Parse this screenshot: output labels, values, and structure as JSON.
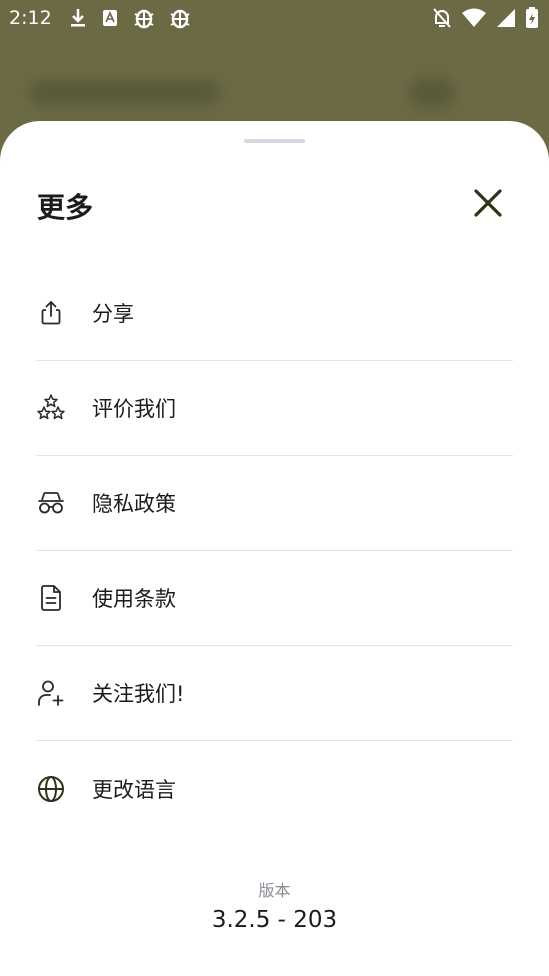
{
  "status_bar": {
    "time": "2:12",
    "left_icons": [
      "download-icon",
      "a-icon",
      "bug-icon",
      "bug-icon"
    ],
    "right_icons": [
      "bell-off-icon",
      "wifi-icon",
      "signal-icon",
      "battery-charging-icon"
    ]
  },
  "sheet": {
    "title": "更多",
    "close_icon": "close-icon"
  },
  "menu": {
    "items": [
      {
        "label": "分享",
        "icon": "share-icon"
      },
      {
        "label": "评价我们",
        "icon": "stars-icon"
      },
      {
        "label": "隐私政策",
        "icon": "incognito-icon"
      },
      {
        "label": "使用条款",
        "icon": "document-icon"
      },
      {
        "label": "关注我们!",
        "icon": "user-plus-icon"
      },
      {
        "label": "更改语言",
        "icon": "globe-icon"
      }
    ]
  },
  "footer": {
    "version_label": "版本",
    "version_value": "3.2.5 - 203"
  },
  "colors": {
    "scrim": "#6b6a45",
    "accent": "#2e3216",
    "text": "#1b1b1b",
    "muted": "#8c8c94",
    "divider": "#e4e3e8"
  }
}
